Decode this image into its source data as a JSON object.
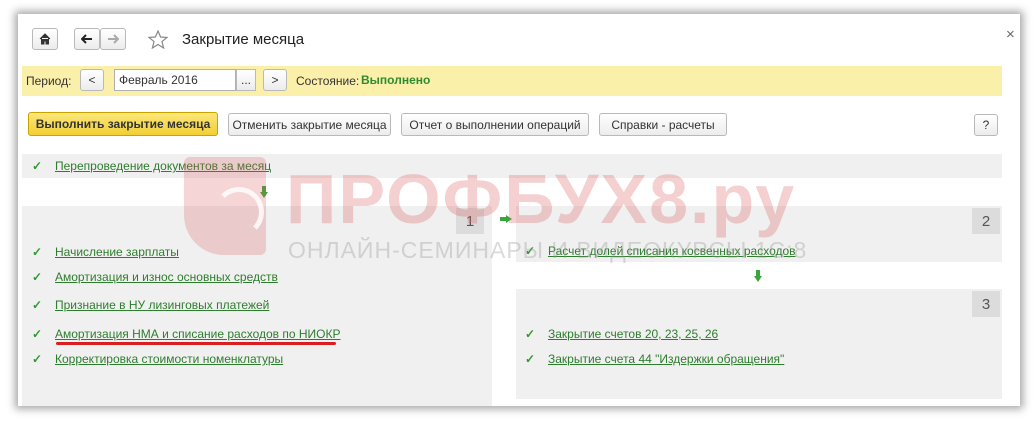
{
  "window": {
    "title": "Закрытие месяца",
    "close_glyph": "×",
    "nav": {
      "home_icon": "home-icon",
      "back_icon": "arrow-left-icon",
      "forward_icon": "arrow-right-icon",
      "star_icon": "star-icon"
    }
  },
  "period": {
    "label": "Период:",
    "prev": "<",
    "value": "Февраль 2016",
    "picker": "...",
    "next": ">",
    "status_label": "Состояние:",
    "status_value": "Выполнено"
  },
  "toolbar": {
    "run": "Выполнить закрытие месяца",
    "cancel": "Отменить закрытие месяца",
    "report": "Отчет о выполнении операций",
    "help_calc": "Справки - расчеты",
    "help": "?"
  },
  "steps": {
    "step0": {
      "items": [
        "Перепроведение документов за месяц"
      ]
    },
    "step1": {
      "number": "1",
      "items": [
        "Начисление зарплаты",
        "Амортизация и износ основных средств",
        "Признание в НУ лизинговых платежей",
        "Амортизация НМА и списание расходов по НИОКР",
        "Корректировка стоимости номенклатуры"
      ]
    },
    "step2": {
      "number": "2",
      "items": [
        "Расчет долей списания косвенных расходов"
      ]
    },
    "step3": {
      "number": "3",
      "items": [
        "Закрытие счетов 20, 23, 25, 26",
        "Закрытие счета 44 \"Издержки обращения\""
      ]
    }
  },
  "watermark": {
    "title": "ПРОФБУХ8.ру",
    "subtitle": "ОНЛАЙН-СЕМИНАРЫ И ВИДЕОКУРСЫ 1С:8"
  },
  "colors": {
    "accent_green": "#2e7d2e",
    "period_bar": "#fbf0a9",
    "primary_button": "#f2cf33",
    "highlight_red": "#d81e1e"
  }
}
